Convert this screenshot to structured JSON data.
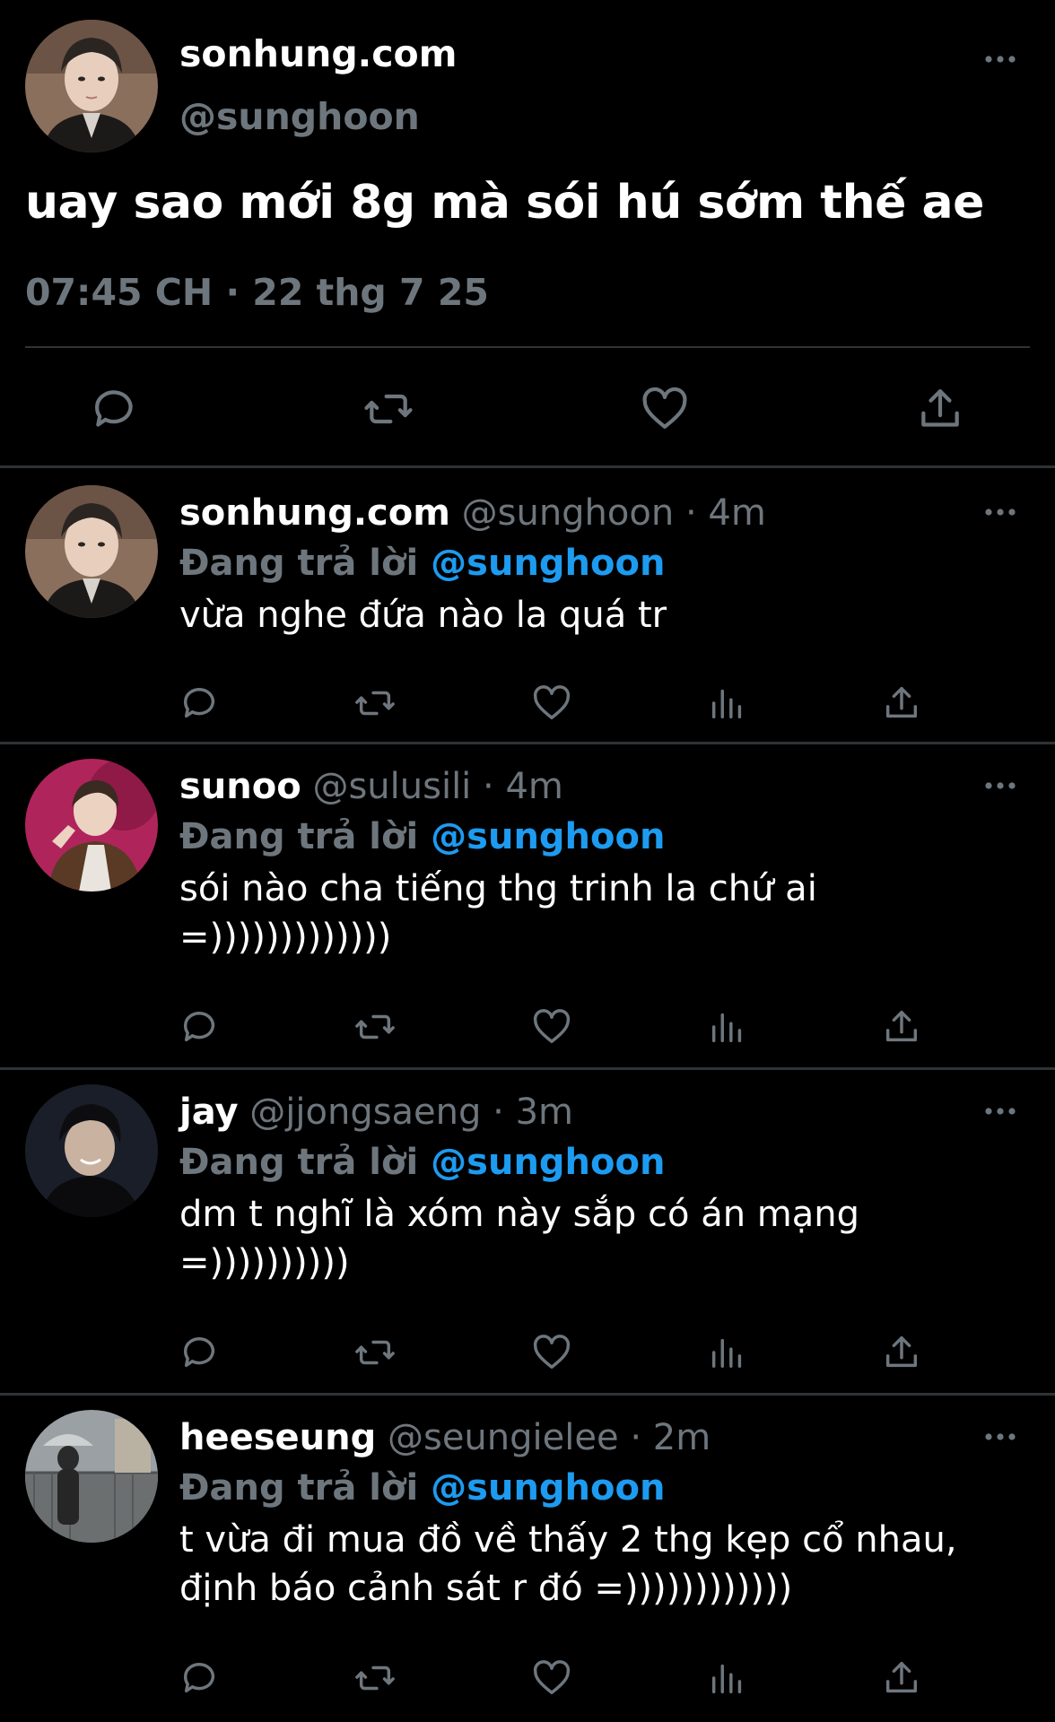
{
  "main_tweet": {
    "display_name": "sonhung.com",
    "handle": "@sunghoon",
    "text": "uay sao mới 8g mà sói hú sớm thế ae",
    "timestamp": "07:45 CH · 22 thg 7 25",
    "avatar_icon": "profile-photo-sunghoon",
    "actions": [
      "reply-icon",
      "retweet-icon",
      "like-icon",
      "share-icon"
    ]
  },
  "replies": [
    {
      "display_name": "sonhung.com",
      "handle": "@sunghoon",
      "time": "· 4m",
      "reply_label": "Đang trả lời",
      "reply_to": "@sunghoon",
      "text": "vừa nghe đứa nào la quá tr",
      "avatar_icon": "profile-photo-sunghoon"
    },
    {
      "display_name": "sunoo",
      "handle": "@sulusili",
      "time": "· 4m",
      "reply_label": "Đang trả lời",
      "reply_to": "@sunghoon",
      "text": "sói nào cha tiếng thg trinh la chứ ai\n=)))))))))))))",
      "avatar_icon": "profile-photo-sunoo"
    },
    {
      "display_name": "jay",
      "handle": "@jjongsaeng",
      "time": "· 3m",
      "reply_label": "Đang trả lời",
      "reply_to": "@sunghoon",
      "text": "dm t nghĩ là xóm này sắp có án mạng\n=))))))))))",
      "avatar_icon": "profile-photo-jay"
    },
    {
      "display_name": "heeseung",
      "handle": "@seungielee",
      "time": "· 2m",
      "reply_label": "Đang trả lời",
      "reply_to": "@sunghoon",
      "text": "t vừa đi mua đồ về thấy 2 thg kẹp cổ nhau,\nđịnh báo cảnh sát r đó =))))))))))))",
      "avatar_icon": "profile-photo-heeseung"
    }
  ],
  "colors": {
    "background": "#000000",
    "text": "#ffffff",
    "muted": "#6e767d",
    "accent": "#1d9bf0",
    "divider": "#2f3336"
  }
}
